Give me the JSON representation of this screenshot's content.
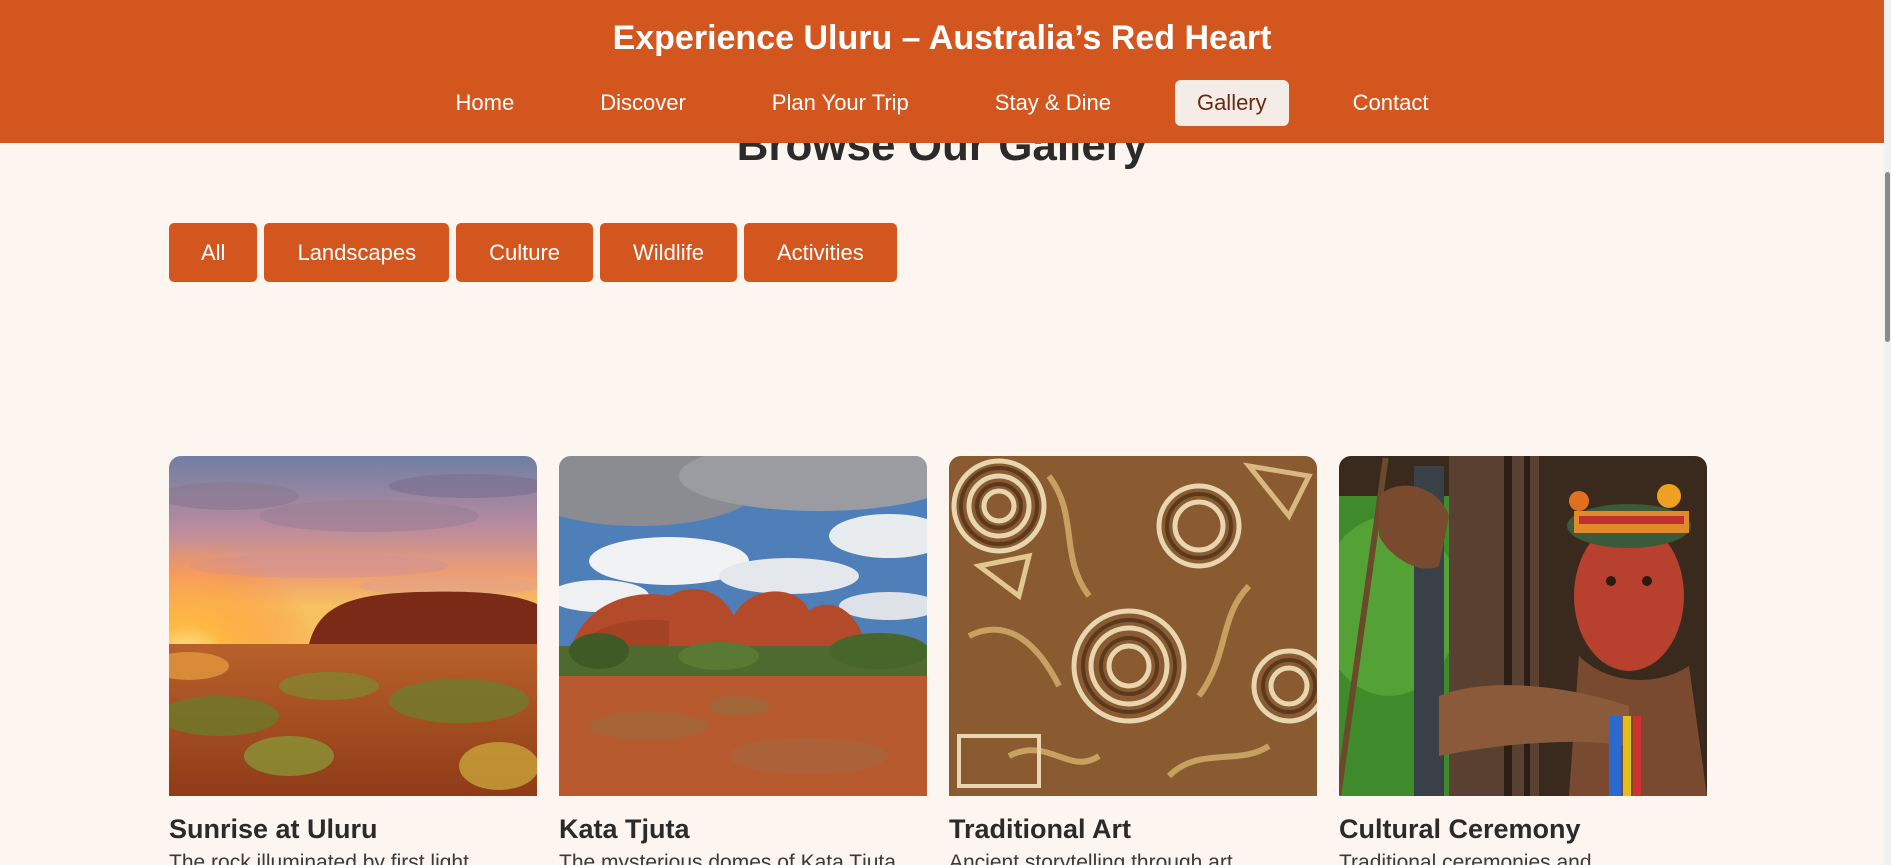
{
  "header": {
    "title": "Experience Uluru – Australia’s Red Heart",
    "background": "#d4561f",
    "nav": [
      {
        "label": "Home",
        "active": false
      },
      {
        "label": "Discover",
        "active": false
      },
      {
        "label": "Plan Your Trip",
        "active": false
      },
      {
        "label": "Stay & Dine",
        "active": false
      },
      {
        "label": "Gallery",
        "active": true
      },
      {
        "label": "Contact",
        "active": false
      }
    ]
  },
  "gallery": {
    "section_title": "Browse Our Gallery",
    "filters": [
      "All",
      "Landscapes",
      "Culture",
      "Wildlife",
      "Activities"
    ],
    "cards": [
      {
        "title": "Sunrise at Uluru",
        "description": "The rock illuminated by first light",
        "image": "uluru-sunrise-photo"
      },
      {
        "title": "Kata Tjuta",
        "description": "The mysterious domes of Kata Tjuta",
        "image": "kata-tjuta-photo"
      },
      {
        "title": "Traditional Art",
        "description": "Ancient storytelling through art",
        "image": "dot-painting-photo"
      },
      {
        "title": "Cultural Ceremony",
        "description": "Traditional ceremonies and",
        "image": "ceremony-portrait-photo"
      }
    ]
  },
  "colors": {
    "accent": "#d4561f",
    "page_background": "#fdf6f0",
    "active_nav_background": "#f4ede7"
  }
}
